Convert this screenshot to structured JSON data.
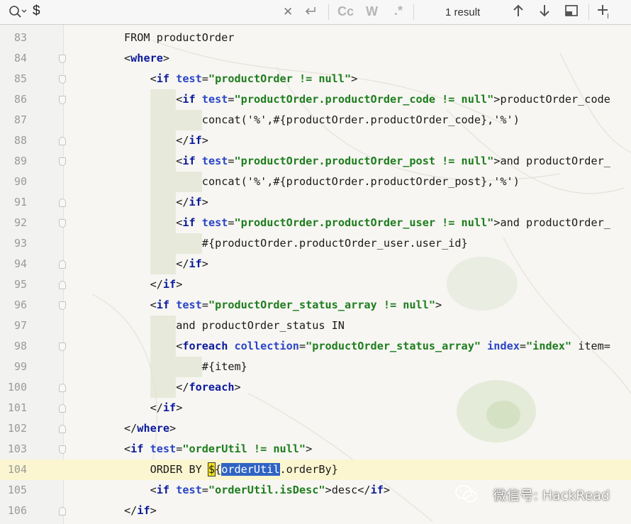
{
  "find_bar": {
    "query": "$",
    "result_label": "1 result",
    "icons": [
      "search-icon",
      "clear-icon",
      "replace-icon",
      "match-case-icon",
      "whole-words-icon",
      "regex-icon",
      "previous-occurrence-icon",
      "next-occurrence-icon",
      "filter-search-results-icon",
      "add-selection-icon"
    ],
    "match_case_label": "Cc",
    "whole_words_label": "W",
    "regex_label": ".*"
  },
  "editor": {
    "current_line": "104",
    "lines": [
      {
        "num": "83",
        "text": "FROM productOrder"
      },
      {
        "num": "84",
        "text": "<where>"
      },
      {
        "num": "85",
        "text": "<if test=\"productOrder != null\">"
      },
      {
        "num": "86",
        "text": "<if test=\"productOrder.productOrder_code != null\">productOrder_code"
      },
      {
        "num": "87",
        "text": "concat('%',#{productOrder.productOrder_code},'%')"
      },
      {
        "num": "88",
        "text": "</if>"
      },
      {
        "num": "89",
        "text": "<if test=\"productOrder.productOrder_post != null\">and productOrder_"
      },
      {
        "num": "90",
        "text": "concat('%',#{productOrder.productOrder_post},'%')"
      },
      {
        "num": "91",
        "text": "</if>"
      },
      {
        "num": "92",
        "text": "<if test=\"productOrder.productOrder_user != null\">and productOrder_"
      },
      {
        "num": "93",
        "text": "#{productOrder.productOrder_user.user_id}"
      },
      {
        "num": "94",
        "text": "</if>"
      },
      {
        "num": "95",
        "text": "</if>"
      },
      {
        "num": "96",
        "text": "<if test=\"productOrder_status_array != null\">"
      },
      {
        "num": "97",
        "text": "and productOrder_status IN"
      },
      {
        "num": "98",
        "text": "<foreach collection=\"productOrder_status_array\" index=\"index\" item="
      },
      {
        "num": "99",
        "text": "#{item}"
      },
      {
        "num": "100",
        "text": "</foreach>"
      },
      {
        "num": "101",
        "text": "</if>"
      },
      {
        "num": "102",
        "text": "</where>"
      },
      {
        "num": "103",
        "text": "<if test=\"orderUtil != null\">"
      },
      {
        "num": "104",
        "text": "ORDER BY ${orderUtil.orderBy}"
      },
      {
        "num": "105",
        "text": "<if test=\"orderUtil.isDesc\">desc</if>"
      },
      {
        "num": "106",
        "text": "</if>"
      }
    ]
  },
  "watermark": {
    "text": "微信号: HackRead"
  },
  "colors": {
    "tag": "#0b1a9c",
    "attribute": "#2a45c8",
    "string": "#1e7d1e",
    "search_match": "#f2e21c",
    "selection": "#2f63c4",
    "current_line": "#fbf6cf"
  }
}
